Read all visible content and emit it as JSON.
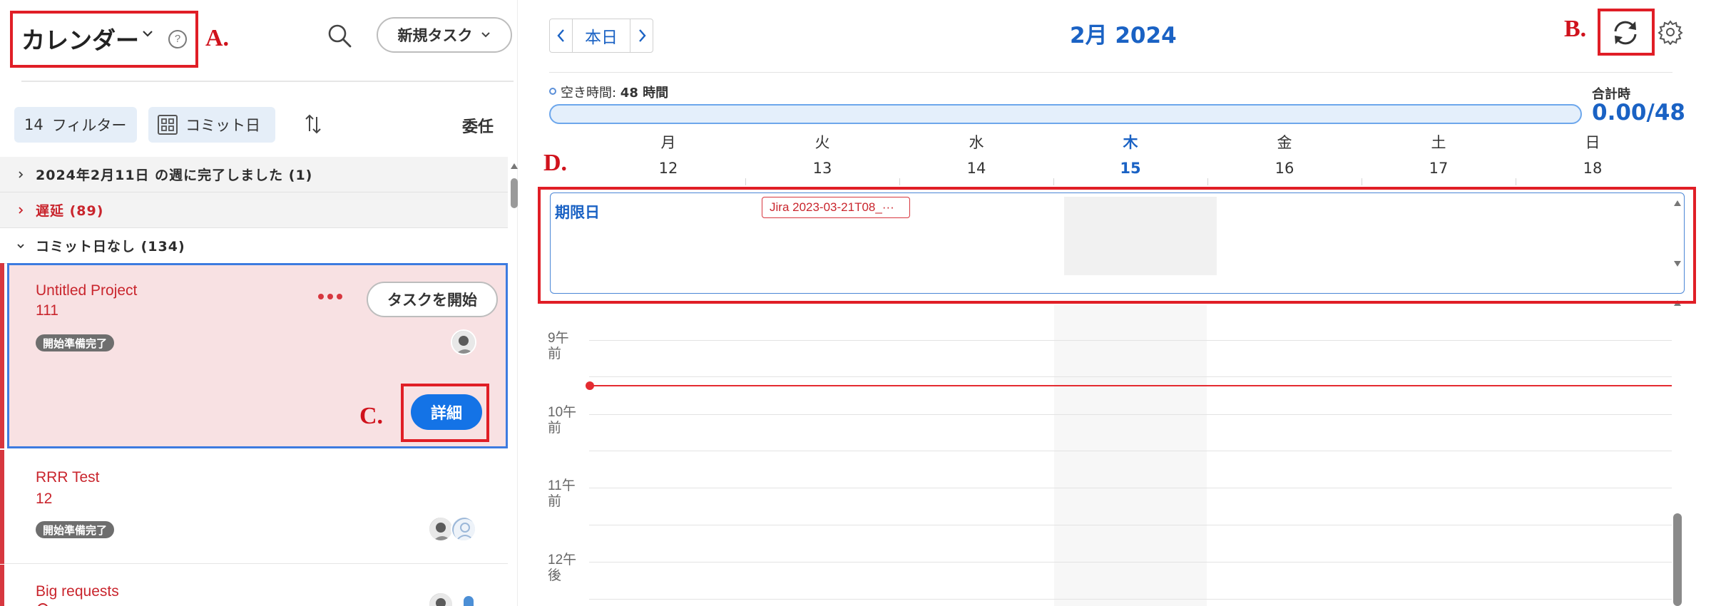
{
  "left_panel": {
    "title": "カレンダー",
    "help_symbol": "?",
    "new_task_label": "新規タスク",
    "filter_count": "14",
    "filter_label": "フィルター",
    "commit_label": "コミット日",
    "delegate_label": "委任",
    "groups": [
      {
        "label": "2024年2月11日 の週に完了しました (1)",
        "color": "#2c2c2c",
        "expanded": false
      },
      {
        "label": "遅延 (89)",
        "color": "#c9252d",
        "expanded": false
      },
      {
        "label": "コミット日なし (134)",
        "color": "#2c2c2c",
        "expanded": true
      }
    ],
    "tasks": [
      {
        "name": "Untitled Project",
        "number": "111",
        "status": "開始準備完了",
        "start_label": "タスクを開始",
        "detail_label": "詳細"
      },
      {
        "name": "RRR Test",
        "number": "12",
        "status": "開始準備完了"
      },
      {
        "name": "Big requests"
      }
    ]
  },
  "calendar": {
    "today_label": "本日",
    "month_title": "2月 2024",
    "free_time_label": "空き時間: ",
    "free_time_value": "48 時間",
    "total_label": "合計時",
    "total_value": "0.00",
    "total_capacity": "/48",
    "days": [
      {
        "name": "月",
        "num": "12"
      },
      {
        "name": "火",
        "num": "13"
      },
      {
        "name": "水",
        "num": "14"
      },
      {
        "name": "木",
        "num": "15",
        "today": true
      },
      {
        "name": "金",
        "num": "16"
      },
      {
        "name": "土",
        "num": "17"
      },
      {
        "name": "日",
        "num": "18"
      }
    ],
    "due_label": "期限日",
    "due_chip": "Jira 2023-03-21T08_···",
    "hours": [
      {
        "top": "9午",
        "bottom": "前"
      },
      {
        "top": "10午",
        "bottom": "前"
      },
      {
        "top": "11午",
        "bottom": "前"
      },
      {
        "top": "12午",
        "bottom": "後"
      }
    ]
  },
  "annotations": {
    "a": "A.",
    "b": "B.",
    "c": "C.",
    "d": "D."
  },
  "colors": {
    "accent": "#1473e6",
    "late": "#c9252d",
    "annotation": "#e01e26",
    "now_line": "#e42b31"
  }
}
